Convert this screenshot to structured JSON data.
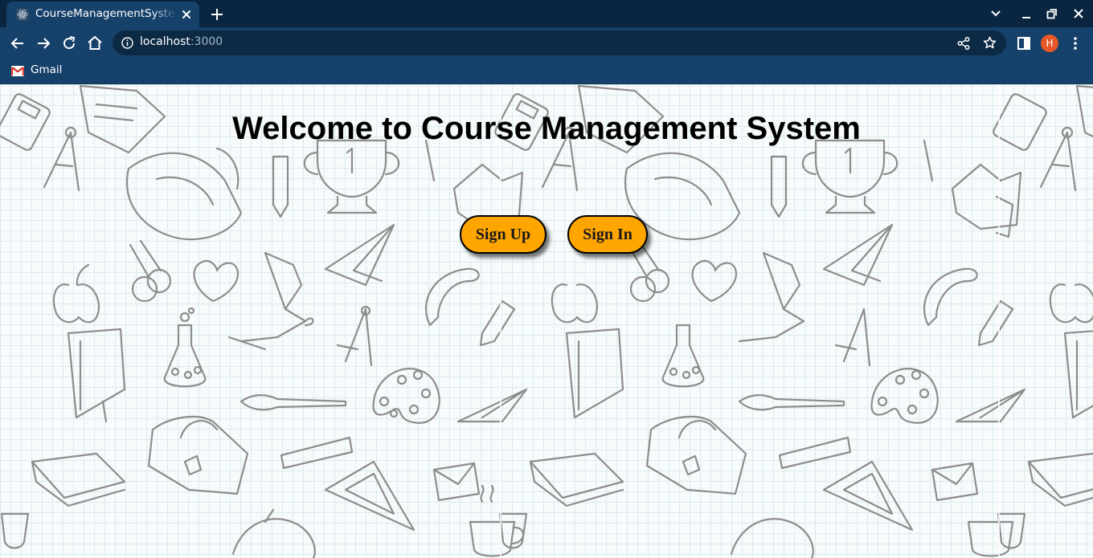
{
  "browser": {
    "tab_title": "CourseManagementSystem",
    "address": {
      "host": "localhost",
      "port": ":3000"
    },
    "bookmarks": [
      {
        "label": "Gmail",
        "icon": "gmail-icon"
      }
    ],
    "profile_initial": "H",
    "profile_color": "#e8572a"
  },
  "page": {
    "heading": "Welcome to Course Management System",
    "signup_label": "Sign Up",
    "signin_label": "Sign In",
    "button_color": "#ffa500"
  }
}
